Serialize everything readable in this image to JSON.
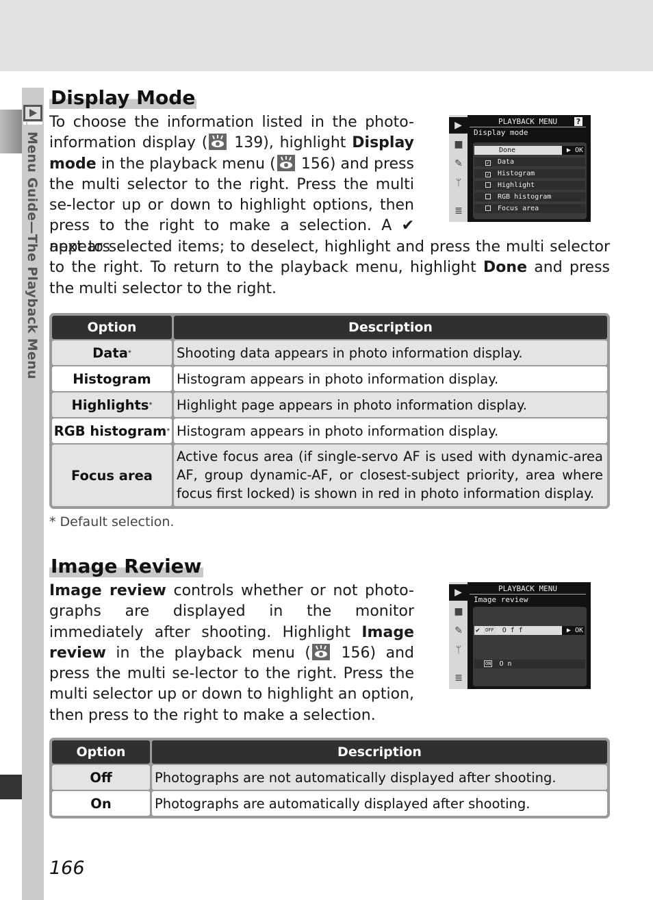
{
  "side_tab": {
    "label": "Menu Guide—The Playback Menu",
    "icon": "playback-icon"
  },
  "display_mode": {
    "title": "Display Mode",
    "paragraph": {
      "p1": "To choose the information listed in the photo-information display (",
      "ref1": "139",
      "p2": "), highlight ",
      "b1": "Display mode",
      "p3": " in the playback menu (",
      "ref2": "156",
      "p4": ") and press the multi selector to the right.  Press the multi se-lector up or down to highlight options, then press to the right to make a selection.  A ",
      "check": "✔",
      "p5": " appears next to selected items; to deselect, highlight and press the multi selector to the right.  To return to the playback menu, highlight ",
      "b2": "Done",
      "p6": " and press the multi selector to the right."
    },
    "lcd": {
      "title": "PLAYBACK MENU",
      "help": "?",
      "subtitle": "Display mode",
      "ok_label": "▶ OK",
      "rows": [
        {
          "label": "Done",
          "checked": null,
          "highlighted": true
        },
        {
          "label": "Data",
          "checked": true
        },
        {
          "label": "Histogram",
          "checked": true
        },
        {
          "label": "Highlight",
          "checked": false
        },
        {
          "label": "RGB histogram",
          "checked": false
        },
        {
          "label": "Focus area",
          "checked": false
        }
      ]
    },
    "table": {
      "headers": [
        "Option",
        "Description"
      ],
      "rows": [
        {
          "option": "Data",
          "default": "*",
          "description": "Shooting data appears in photo information display."
        },
        {
          "option": "Histogram",
          "default": "",
          "description": "Histogram appears in photo information display."
        },
        {
          "option": "Highlights",
          "default": "*",
          "description": "Highlight page appears in photo information display."
        },
        {
          "option": "RGB histogram",
          "default": "*",
          "description": "Histogram appears in photo information display."
        },
        {
          "option": "Focus area",
          "default": "",
          "description": "Active focus area (if single-servo AF is used with dynamic-area AF, group dynamic-AF, or closest-subject priority, area where focus first locked) is shown in red in photo information display."
        }
      ]
    },
    "footnote": "* Default selection."
  },
  "image_review": {
    "title": "Image Review",
    "paragraph": {
      "b1": "Image review",
      "p1": " controls whether or not photo-graphs are displayed in the monitor immediately after shooting.  Highlight ",
      "b2": "Image review",
      "p2": " in the playback menu (",
      "ref1": "156",
      "p3": ") and press the multi se-lector to the right.  Press the multi selector up or down to highlight an option, then press to the right to make a selection."
    },
    "lcd": {
      "title": "PLAYBACK MENU",
      "subtitle": "Image review",
      "ok_label": "▶ OK",
      "rows": [
        {
          "badge": "OFF",
          "label": "O f f",
          "selected": true,
          "highlighted": true
        },
        {
          "badge": "ON",
          "label": "O n",
          "selected": false
        }
      ]
    },
    "table": {
      "headers": [
        "Option",
        "Description"
      ],
      "rows": [
        {
          "option": "Off",
          "description": "Photographs are not automatically displayed after shooting."
        },
        {
          "option": "On",
          "description": "Photographs are automatically displayed after shooting."
        }
      ]
    }
  },
  "page_number": "166"
}
